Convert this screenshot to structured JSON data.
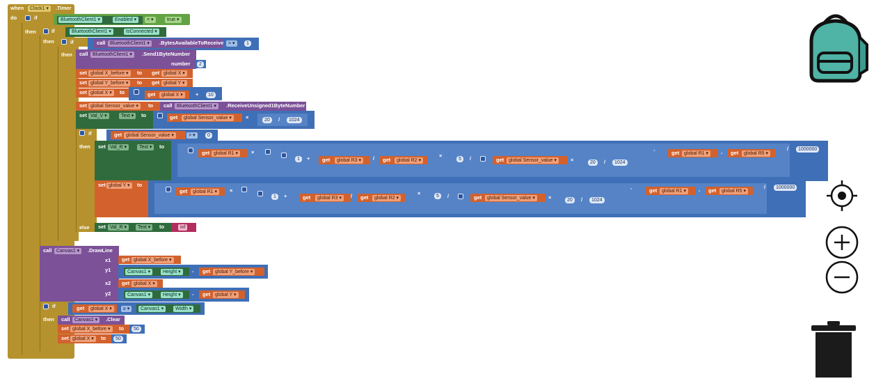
{
  "labels": {
    "when": "when",
    "do": "do",
    "if": "if",
    "then": "then",
    "else": "else",
    "call": "call",
    "set": "set",
    "get": "get",
    "to": "to",
    "number": "number",
    "x1": "x1",
    "y1": "y1",
    "x2": "x2",
    "y2": "y2"
  },
  "event": {
    "component": "Clock1 ▾",
    "event": ".Timer"
  },
  "if1": {
    "component": "BluetoothClient1 ▾",
    "prop": "Enabled ▾",
    "op": "= ▾",
    "value": "true ▾"
  },
  "if2": {
    "component": "BluetoothClient1 ▾",
    "prop": "IsConnected ▾"
  },
  "if3": {
    "component": "BluetoothClient1 ▾",
    "method": ".BytesAvailableToReceive",
    "op": "> ▾",
    "value": "1"
  },
  "send": {
    "component": "BluetoothClient1 ▾",
    "method": ".Send1ByteNumber",
    "number": "2"
  },
  "set_xbefore": {
    "var": "global X_before ▾",
    "get": "global X ▾"
  },
  "set_ybefore": {
    "var": "global Y_before ▾",
    "get": "global Y ▾"
  },
  "set_x": {
    "var": "global X ▾",
    "get": "global X ▾",
    "op": "+",
    "value": "10"
  },
  "set_sensor": {
    "var": "global Sensor_value ▾",
    "component": "BluetoothClient1 ▾",
    "method": ".ReceiveUnsigned1ByteNumber"
  },
  "set_valv": {
    "component": "Val_V ▾",
    "prop": "Text ▾",
    "get": "global Sensor_value ▾",
    "op": "×",
    "a": "20",
    "div": "/",
    "b": "1024"
  },
  "if4": {
    "get": "global Sensor_value ▾",
    "op": "> ▾",
    "value": "0"
  },
  "set_valr": {
    "component": "Val_R ▾",
    "prop": "Text ▾",
    "r1": "global R1 ▾",
    "times": "×",
    "one": "1",
    "plus": "+",
    "r3": "global R3 ▾",
    "slash": "/",
    "r2": "global R2 ▾",
    "five": "5",
    "sensor": "global Sensor_value ▾",
    "a": "20",
    "b": "1024",
    "minus": "-",
    "r1b": "global R1 ▾",
    "r5": "global R5 ▾",
    "million": "1000000"
  },
  "set_y": {
    "var": "global Y ▾",
    "r1": "global R1 ▾",
    "times": "×",
    "one": "1",
    "plus": "+",
    "r3": "global R3 ▾",
    "slash": "/",
    "r2": "global R2 ▾",
    "five": "5",
    "sensor": "global Sensor_value ▾",
    "a": "20",
    "b": "1024",
    "minus": "-",
    "r1b": "global R1 ▾",
    "r5": "global R5 ▾",
    "million": "1000000"
  },
  "else_set": {
    "component": "Val_R ▾",
    "prop": "Text ▾",
    "text": "inf"
  },
  "drawline": {
    "component": "Canvas1 ▾",
    "method": ".DrawLine",
    "x1": "global X_before ▾",
    "y1_comp": "Canvas1 ▾",
    "y1_prop": "Height ▾",
    "y1_op": "-",
    "y1_get": "global Y_before ▾",
    "x2": "global X ▾",
    "y2_comp": "Canvas1 ▾",
    "y2_prop": "Height ▾",
    "y2_op": "-",
    "y2_get": "global Y ▾"
  },
  "if5": {
    "get": "global X ▾",
    "op": "≥ ▾",
    "component": "Canvas1 ▾",
    "prop": "Width ▾"
  },
  "clear": {
    "component": "Canvas1 ▾",
    "method": ".Clear"
  },
  "reset_xbefore": {
    "var": "global X_before ▾",
    "value": "50"
  },
  "reset_x": {
    "var": "global X ▾",
    "value": "50"
  },
  "icons": [
    "backpack-icon",
    "target-icon",
    "zoom-in-icon",
    "zoom-out-icon",
    "trash-icon"
  ],
  "colors": {
    "control": "#b5922d",
    "logic": "#64a343",
    "math": "#3f6fb6",
    "procedure": "#7c5198",
    "variable": "#d2612d",
    "component": "#2f6b3c",
    "text": "#b32d5e",
    "backpack": "#4fb3a5"
  }
}
